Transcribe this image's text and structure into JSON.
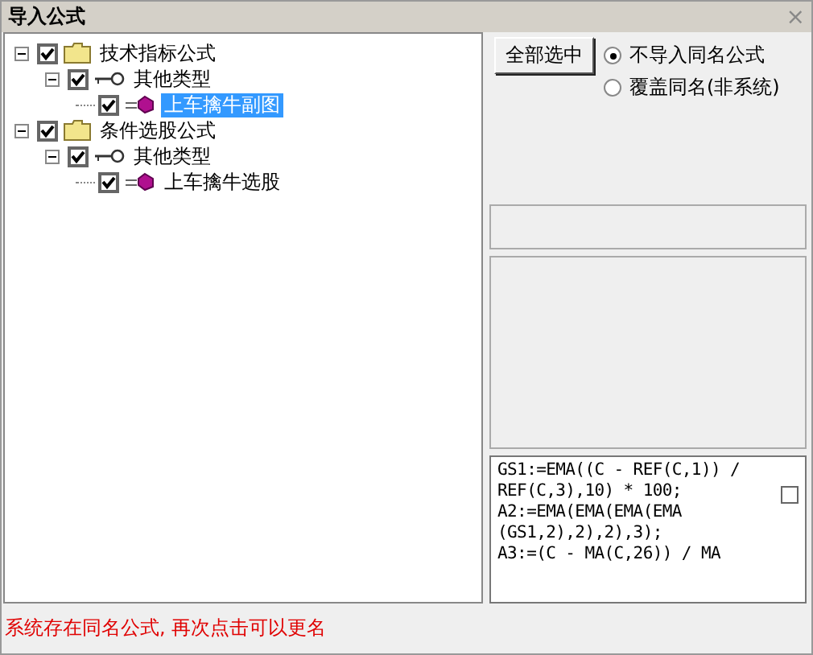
{
  "window": {
    "title": "导入公式",
    "close": "×"
  },
  "tree": [
    {
      "kind": "folder",
      "label": "技术指标公式",
      "checked": true,
      "expanded": true,
      "selected": false,
      "children": [
        {
          "kind": "type",
          "label": "其他类型",
          "checked": true,
          "expanded": true,
          "selected": false,
          "children": [
            {
              "kind": "formula",
              "label": "上车擒牛副图",
              "checked": true,
              "selected": true
            }
          ]
        }
      ]
    },
    {
      "kind": "folder",
      "label": "条件选股公式",
      "checked": true,
      "expanded": true,
      "selected": false,
      "children": [
        {
          "kind": "type",
          "label": "其他类型",
          "checked": true,
          "expanded": true,
          "selected": false,
          "children": [
            {
              "kind": "formula",
              "label": "上车擒牛选股",
              "checked": true,
              "selected": false
            }
          ]
        }
      ]
    }
  ],
  "select_all_button": "全部选中",
  "options": [
    {
      "label": "不导入同名公式",
      "selected": true
    },
    {
      "label": "覆盖同名(非系统)",
      "selected": false
    }
  ],
  "code_lines": [
    "GS1:=EMA((C - REF(C,1)) /",
    "REF(C,3),10) * 100;",
    "A2:=EMA(EMA(EMA(EMA",
    "(GS1,2),2),2),3);",
    "A3:=(C - MA(C,26)) / MA"
  ],
  "code_checkbox": {
    "checked": false
  },
  "status": "系统存在同名公式, 再次点击可以更名"
}
